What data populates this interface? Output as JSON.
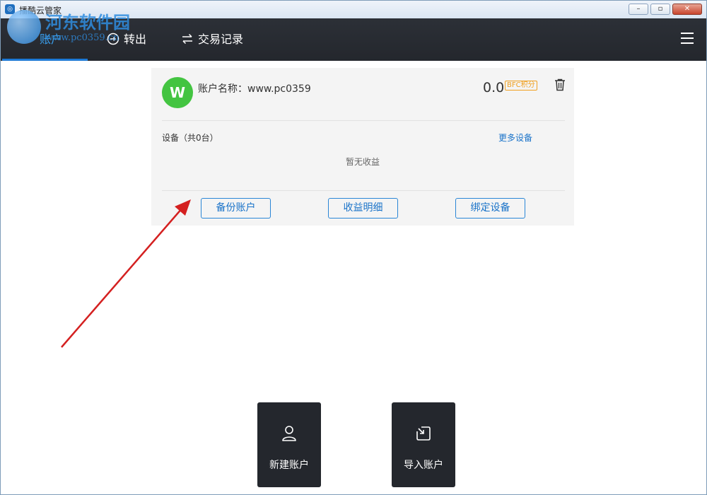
{
  "window": {
    "title": "播酷云管家",
    "buttons": [
      "minimize",
      "maximize",
      "close"
    ]
  },
  "watermark": {
    "title": "河东软件园",
    "url": "www.pc0359.cn"
  },
  "nav": {
    "tabs": [
      {
        "label": "账户",
        "icon": "wallet-icon",
        "active": true
      },
      {
        "label": "转出",
        "icon": "transfer-out-icon",
        "active": false
      },
      {
        "label": "交易记录",
        "icon": "exchange-icon",
        "active": false
      }
    ],
    "menu_icon": "hamburger-menu-icon"
  },
  "account_card": {
    "avatar_letter": "W",
    "name_label": "账户名称：www.pc0359",
    "balance": "0.0",
    "balance_unit": "BFC积分",
    "devices_label": "设备（共0台）",
    "more_devices": "更多设备",
    "empty_text": "暂无收益",
    "actions": {
      "backup": "备份账户",
      "earnings": "收益明细",
      "bind": "绑定设备"
    }
  },
  "bottom_actions": {
    "new_account": {
      "label": "新建账户",
      "icon": "user-icon"
    },
    "import_account": {
      "label": "导入账户",
      "icon": "import-icon"
    }
  },
  "colors": {
    "nav_bg": "#26292f",
    "accent": "#1e7ad6",
    "avatar_bg": "#43c441",
    "badge": "#f0a020",
    "annotation_arrow": "#d42020"
  }
}
